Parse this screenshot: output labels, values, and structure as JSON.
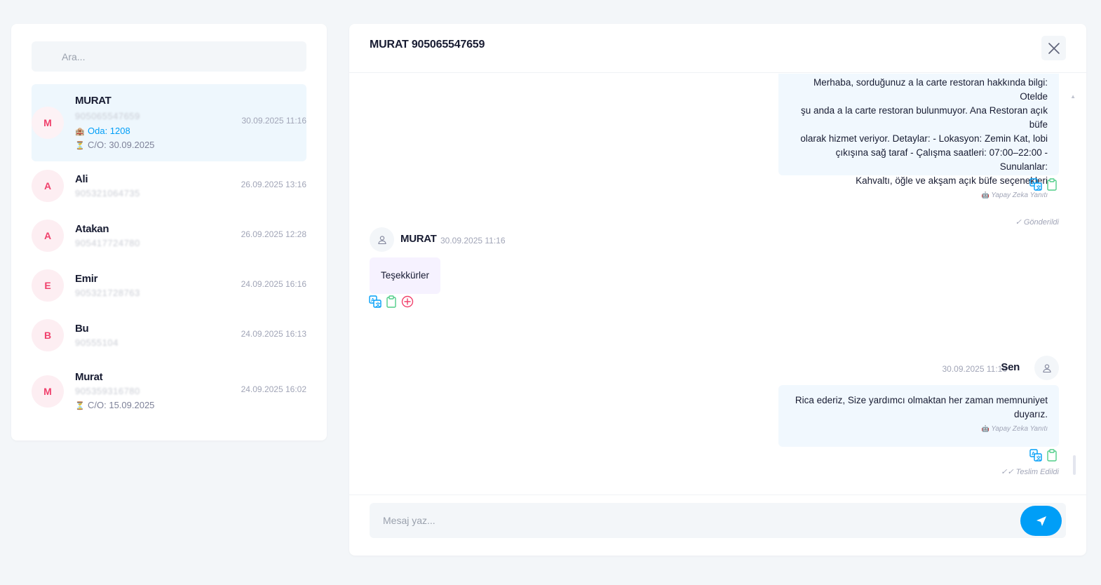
{
  "search": {
    "placeholder": "Ara..."
  },
  "contacts": [
    {
      "initial": "M",
      "name": "MURAT",
      "phone": "905065547659",
      "room": "Oda: 1208",
      "checkout": "C/O: 30.09.2025",
      "time": "30.09.2025 11:16"
    },
    {
      "initial": "A",
      "name": "Ali",
      "phone": "905321064735",
      "time": "26.09.2025 13:16"
    },
    {
      "initial": "A",
      "name": "Atakan",
      "phone": "905417724780",
      "time": "26.09.2025 12:28"
    },
    {
      "initial": "E",
      "name": "Emir",
      "phone": "905321728763",
      "time": "24.09.2025 16:16"
    },
    {
      "initial": "B",
      "name": "Bu",
      "phone": "90555104",
      "time": "24.09.2025 16:13"
    },
    {
      "initial": "M",
      "name": "Murat",
      "phone": "905359316780",
      "checkout": "C/O: 15.09.2025",
      "time": "24.09.2025 16:02"
    }
  ],
  "chat": {
    "title": "MURAT 905065547659",
    "messages": [
      {
        "lines": [
          "Merhaba, sorduğunuz a la carte restoran hakkında bilgi: Otelde",
          "şu anda a la carte restoran bulunmuyor. Ana Restoran açık büfe",
          "olarak hizmet veriyor. Detaylar: - Lokasyon: Zemin Kat, lobi",
          "çıkışına sağ taraf - Çalışma saatleri: 07:00–22:00 - Sunulanlar:",
          "Kahvaltı, öğle ve akşam açık büfe seçenekleri"
        ],
        "tag": "Yapay Zeka Yanıtı",
        "status": "Gönderildi"
      },
      {
        "sender": "MURAT",
        "time": "30.09.2025 11:16",
        "text": "Teşekkürler"
      },
      {
        "sender": "Sen",
        "time": "30.09.2025 11:16",
        "lines": [
          "Rica ederiz, Size yardımcı olmaktan her zaman memnuniyet",
          "duyarız."
        ],
        "tag": "Yapay Zeka Yanıtı",
        "status": "Teslim Edildi"
      }
    ]
  },
  "composer": {
    "placeholder": "Mesaj yaz..."
  },
  "icons": {
    "search": "search-icon",
    "close": "close-icon",
    "translate": "translate-icon",
    "copy": "clipboard-icon",
    "add": "plus-circle-icon",
    "send": "send-icon",
    "user": "user-icon",
    "robot": "robot-icon",
    "hotel": "hotel-icon",
    "hourglass": "hourglass-icon",
    "check": "check-icon",
    "double_check": "double-check-icon"
  },
  "colors": {
    "accent": "#009ef7",
    "avatar_text": "#f0416c",
    "copy_green": "#50cd89",
    "add_red": "#f1416c"
  }
}
